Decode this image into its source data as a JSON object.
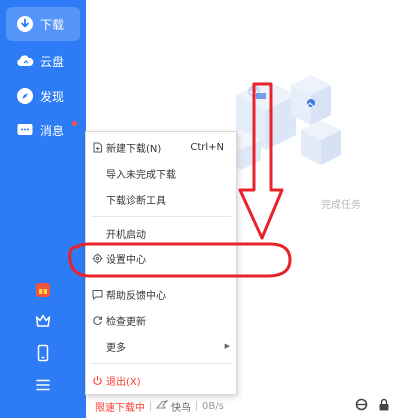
{
  "sidebar": {
    "items": [
      {
        "label": "下载",
        "icon": "download-icon",
        "active": true
      },
      {
        "label": "云盘",
        "icon": "cloud-icon",
        "active": false
      },
      {
        "label": "发现",
        "icon": "compass-icon",
        "active": false
      },
      {
        "label": "消息",
        "icon": "message-icon",
        "active": false,
        "badge": true
      }
    ],
    "bottom_icons": [
      "gift-icon",
      "crown-icon",
      "phone-icon",
      "menu-icon"
    ]
  },
  "main": {
    "empty_text": "完成任务"
  },
  "menu": {
    "items": [
      {
        "label": "新建下载(N)",
        "shortcut": "Ctrl+N",
        "icon": "new-file-icon"
      },
      {
        "label": "导入未完成下载"
      },
      {
        "label": "下载诊断工具"
      },
      {
        "label": "开机启动"
      },
      {
        "label": "设置中心",
        "icon": "gear-icon"
      },
      {
        "label": "帮助反馈中心",
        "icon": "feedback-icon"
      },
      {
        "label": "检查更新",
        "icon": "refresh-icon"
      },
      {
        "label": "更多",
        "submenu": true
      },
      {
        "label": "退出(X)",
        "icon": "power-icon"
      }
    ]
  },
  "statusbar": {
    "limit_label": "限速下载中",
    "quick_label": "快鸟",
    "speed": "0B/s"
  },
  "colors": {
    "sidebar_bg": "#2e7bf6",
    "sidebar_active": "#5594f8",
    "annotation_red": "#e8232a",
    "exit_red": "#ff3b30"
  }
}
